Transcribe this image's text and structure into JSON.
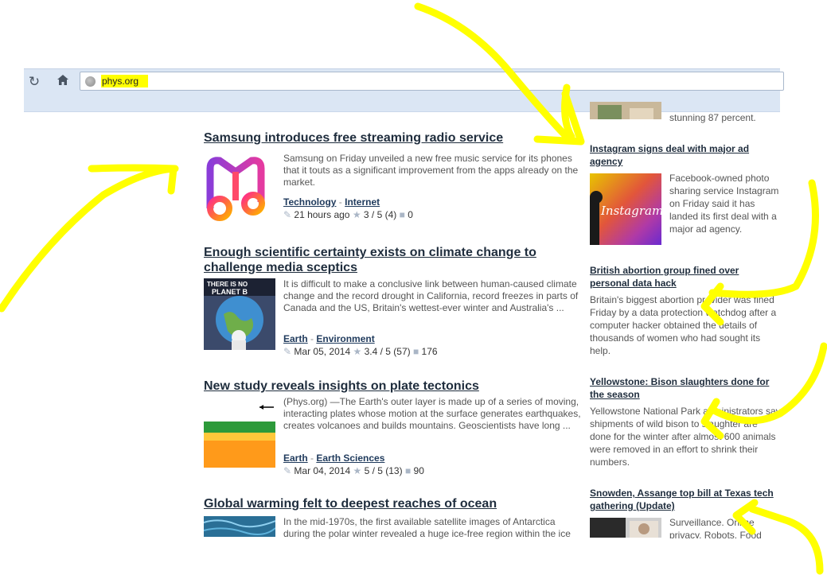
{
  "browser": {
    "reload_icon": "reload-icon",
    "home_icon": "home-icon",
    "url": "phys.org"
  },
  "main_articles": [
    {
      "title": "Samsung introduces free streaming radio service",
      "summary": "Samsung on Friday unveiled a new free music service for its phones that it touts as a significant improvement from the apps already on the market.",
      "tags": [
        "Technology",
        "Internet"
      ],
      "time": "21 hours ago",
      "rating": "3 / 5 (4)",
      "comments": "0",
      "thumb_icon": "milk-music-logo"
    },
    {
      "title": "Enough scientific certainty exists on climate change to challenge media sceptics",
      "summary": "It is difficult to make a conclusive link between human-caused climate change and the record drought in California, record freezes in parts of Canada and the US, Britain's wettest-ever winter and Australia's ...",
      "tags": [
        "Earth",
        "Environment"
      ],
      "time": "Mar 05, 2014",
      "rating": "3.4 / 5 (57)",
      "comments": "176",
      "thumb_text": "THERE IS NO PLANET B"
    },
    {
      "title": "New study reveals insights on plate tectonics",
      "summary": "(Phys.org) —The Earth's outer layer is made up of a series of moving, interacting plates whose motion at the surface generates earthquakes, creates volcanoes and builds mountains. Geoscientists have long ...",
      "tags": [
        "Earth",
        "Earth Sciences"
      ],
      "time": "Mar 04, 2014",
      "rating": "5 / 5 (13)",
      "comments": "90"
    },
    {
      "title": "Global warming felt to deepest reaches of ocean",
      "summary": "In the mid-1970s, the first available satellite images of Antarctica during the polar winter revealed a huge ice-free region within the ice"
    }
  ],
  "side_articles": [
    {
      "text_tail": "stunning 87 percent."
    },
    {
      "title": "Instagram signs deal with major ad agency",
      "summary": "Facebook-owned photo sharing service Instagram on Friday said it has landed its first deal with a major ad agency.",
      "thumb_text": "Instagram"
    },
    {
      "title": "British abortion group fined over personal data hack",
      "summary": "Britain's biggest abortion provider was fined Friday by a data protection watchdog after a computer hacker obtained the details of thousands of women who had sought its help."
    },
    {
      "title": "Yellowstone: Bison slaughters done for the season",
      "summary": "Yellowstone National Park administrators say shipments of wild bison to slaughter are done for the winter after almost 600 animals were removed in an effort to shrink their numbers."
    },
    {
      "title": "Snowden, Assange top bill at Texas tech gathering (Update)",
      "summary": "Surveillance. Online privacy. Robots. Food"
    }
  ],
  "icons": {
    "edit": "pencil-icon",
    "rating": "star-icon",
    "comments": "comment-icon"
  },
  "colors": {
    "annotation": "#ffff00",
    "toolbar": "#dbe6f4",
    "link": "#1f2d3d"
  }
}
